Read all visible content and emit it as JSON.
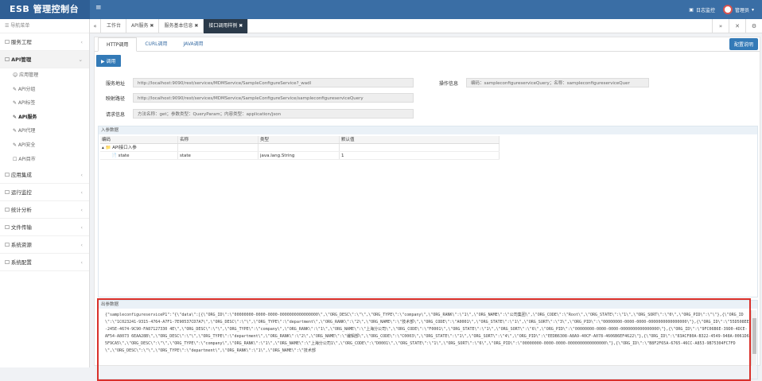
{
  "app": {
    "title": "ESB 管理控制台"
  },
  "header": {
    "menu_icon": "≡",
    "log_monitor": "日志监控",
    "user": "管理员"
  },
  "sidebar": {
    "nav_label": "导航菜单",
    "items": [
      {
        "label": "服务工程",
        "arrow": "‹"
      },
      {
        "label": "API管理",
        "arrow": "⌄"
      },
      {
        "label": "应用集成",
        "arrow": "‹"
      },
      {
        "label": "运行监控",
        "arrow": "‹"
      },
      {
        "label": "统计分析",
        "arrow": "‹"
      },
      {
        "label": "文件传输",
        "arrow": "‹"
      },
      {
        "label": "系统资源",
        "arrow": "‹"
      },
      {
        "label": "系统配置",
        "arrow": "‹"
      }
    ],
    "subitems": [
      {
        "label": "☺ 应用管理"
      },
      {
        "label": "✎ API分组"
      },
      {
        "label": "✎ API标签"
      },
      {
        "label": "✎ API服务"
      },
      {
        "label": "✎ API代理"
      },
      {
        "label": "✎ API安全"
      },
      {
        "label": "☐ API目市"
      }
    ]
  },
  "tabs": {
    "prev": "«",
    "items": [
      {
        "label": "工作台"
      },
      {
        "label": "API服务 ✖"
      },
      {
        "label": "服务基本信息 ✖"
      },
      {
        "label": "接口调用样例 ✖"
      }
    ],
    "next": "»",
    "close": "✕",
    "settings": "⚙"
  },
  "subtabs": [
    "HTTP调用",
    "CURL调用",
    "JAVA调用"
  ],
  "buttons": {
    "config": "配置说明",
    "invoke": "▶ 调用"
  },
  "form": {
    "service_address_label": "服务地址",
    "service_address": "http://localhost:9090/rest/services/MDMService/SampleConfigureService?_wadl",
    "request_path_label": "映射路径",
    "request_path": "http://localhost:9090/rest/services/MDMService/SampleConfigureService/sampleconfigureserviceQuery",
    "request_info_label": "请求信息",
    "request_info": "方法名称：get；参数类型：QueryParam；内容类型：application/json",
    "operation_info_label": "操作信息",
    "operation_info": "编码：sampleconfigureserviceQuery；名称：sampleconfigureserviceQuer"
  },
  "input_panel": {
    "title": "入参数据",
    "columns": [
      "编码",
      "名称",
      "类型",
      "默认值"
    ],
    "rows": [
      {
        "code": "▴ 📁 API接口入参",
        "name": "",
        "type": "",
        "default": ""
      },
      {
        "code": "📄 state",
        "name": "state",
        "type": "java.lang.String",
        "default": "1"
      }
    ]
  },
  "output_panel": {
    "title": "出参数据",
    "text": "{\"sampleconfigureserviceP1\":\"{\\\"data\\\":[{\\\"ORG_ID\\\":\\\"00000000-0000-0000-0000000000000000\\\",\\\"ORG_DESC\\\":\\\"\\\",\\\"ORG_TYPE\\\":\\\"company\\\",\\\"ORG_RANK\\\":\\\"1\\\",\\\"ORG_NAME\\\":\\\"公司集团\\\",\\\"ORG_CODE\\\":\\\"Root\\\",\\\"ORG_STATE\\\":\\\"1\\\",\\\"ORG_SORT\\\":\\\"0\\\",\\\"ORG_PID\\\":\\\"\\\"},{\\\"ORG_ID\\\":\\\"1C023241-9315-4764-A7F1-7E90537CD7A7\\\",\\\"ORG_DESC\\\":\\\"\\\",\\\"ORG_TYPE\\\":\\\"department\\\",\\\"ORG_RANK\\\":\\\"2\\\",\\\"ORG_NAME\\\":\\\"技术部\\\",\\\"ORG_CODE\\\":\\\"A0001\\\",\\\"ORG_STATE\\\":\\\"1\\\",\\\"ORG_SORT\\\":\\\"3\\\",\\\"ORG_PID\\\":\\\"00000000-0000-0000-0000000000000000\\\"},{\\\"ORG_ID\\\":\\\"55D508EE-245E-4674-9C90-FA87127330 4E\\\",\\\"ORG_DESC\\\":\\\"\\\",\\\"ORG_TYPE\\\":\\\"company\\\",\\\"ORG_RANK\\\":\\\"1\\\",\\\"ORG_NAME\\\":\\\"上海分公司\\\",\\\"ORG_CODE\\\":\\\"F0001\\\",\\\"ORG_STATE\\\":\\\"1\\\",\\\"ORG_SORT\\\":\\\"6\\\",\\\"ORG_PID\\\":\\\"00000000-0000-0000-0000000000000000\\\"},{\\\"ORG_ID\\\":\\\"9FC06B6E-39D0-4DCE-AF54-A8073 6EAA28B\\\",\\\"ORG_DESC\\\":\\\"\\\",\\\"ORG_TYPE\\\":\\\"department\\\",\\\"ORG_RANK\\\":\\\"2\\\",\\\"ORG_NAME\\\":\\\"编辑部\\\",\\\"ORG_CODE\\\":\\\"C0003\\\",\\\"ORG_STATE\\\":\\\"1\\\",\\\"ORG_SORT\\\":\\\"4\\\",\\\"ORG_PID\\\":\\\"EEDB6308-A8A9-40CF-A078-4606B6EF4622\\\"},{\\\"ORG_ID\\\":\\\"83ACF80A-B322-4549-948A-0061D65F9CA5\\\",\\\"ORG_DESC\\\":\\\"\\\",\\\"ORG_TYPE\\\":\\\"company\\\",\\\"ORG_RANK\\\":\\\"1\\\",\\\"ORG_NAME\\\":\\\"上海分公司1\\\",\\\"ORG_CODE\\\":\\\"D0001\\\",\\\"ORG_STATE\\\":\\\"1\\\",\\\"ORG_SORT\\\":\\\"6\\\",\\\"ORG_PID\\\":\\\"00000000-0000-0000-0000000000000000\\\"},{\\\"ORG_ID\\\":\\\"B8F2F65A-6765-46CC-A853-9B75304FC7FD\\\",\\\"ORG_DESC\\\":\\\"\\\",\\\"ORG_TYPE\\\":\\\"department\\\",\\\"ORG_RANK\\\":\\\"1\\\",\\\"ORG_NAME\\\":\\\"技术部"
  },
  "colors": {
    "topbar": "#3a6ea5",
    "active_tab": "#2b3a4a",
    "button": "#337ab7",
    "highlight": "#d9302a"
  }
}
